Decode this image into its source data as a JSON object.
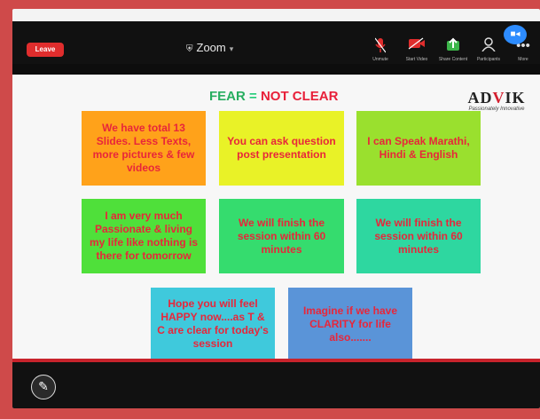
{
  "app": {
    "title": "Zoom",
    "leave_label": "Leave"
  },
  "toolbar": {
    "items": [
      {
        "label": "Unmute",
        "icon": "microphone-muted-icon"
      },
      {
        "label": "Start Video",
        "icon": "video-off-icon"
      },
      {
        "label": "Share Content",
        "icon": "share-screen-icon"
      },
      {
        "label": "Participants",
        "icon": "participants-icon"
      },
      {
        "label": "More",
        "icon": "more-icon"
      }
    ]
  },
  "slide": {
    "title_part1": "FEAR",
    "title_eq": "=",
    "title_part2": "NOT CLEAR",
    "logo_prefix": "AD",
    "logo_v": "V",
    "logo_suffix": "IK",
    "logo_tagline": "Passionately Innovative",
    "cards": [
      {
        "text": "We have total 13 Slides. Less Texts, more pictures & few videos",
        "bg": "#ffa21a"
      },
      {
        "text": "You can ask question post presentation",
        "bg": "#e9f227"
      },
      {
        "text": "I can Speak Marathi, Hindi & English",
        "bg": "#9ae02e"
      },
      {
        "text": "I am very much Passionate & living my life like nothing is there for tomorrow",
        "bg": "#4fe03a"
      },
      {
        "text": "We will finish the session within 60 minutes",
        "bg": "#35dc6e"
      },
      {
        "text": "We will finish the session within 60 minutes",
        "bg": "#2ed7a0"
      },
      {
        "text": "Hope you will feel HAPPY now....as T & C are clear for today's session",
        "bg": "#3fc9dc"
      },
      {
        "text": "Imagine if we have CLARITY for life also.......",
        "bg": "#5a94d8"
      }
    ]
  },
  "colors": {
    "accent_red": "#e02d2d",
    "card_text": "#e8263a",
    "zoom_blue": "#2d8cff"
  }
}
